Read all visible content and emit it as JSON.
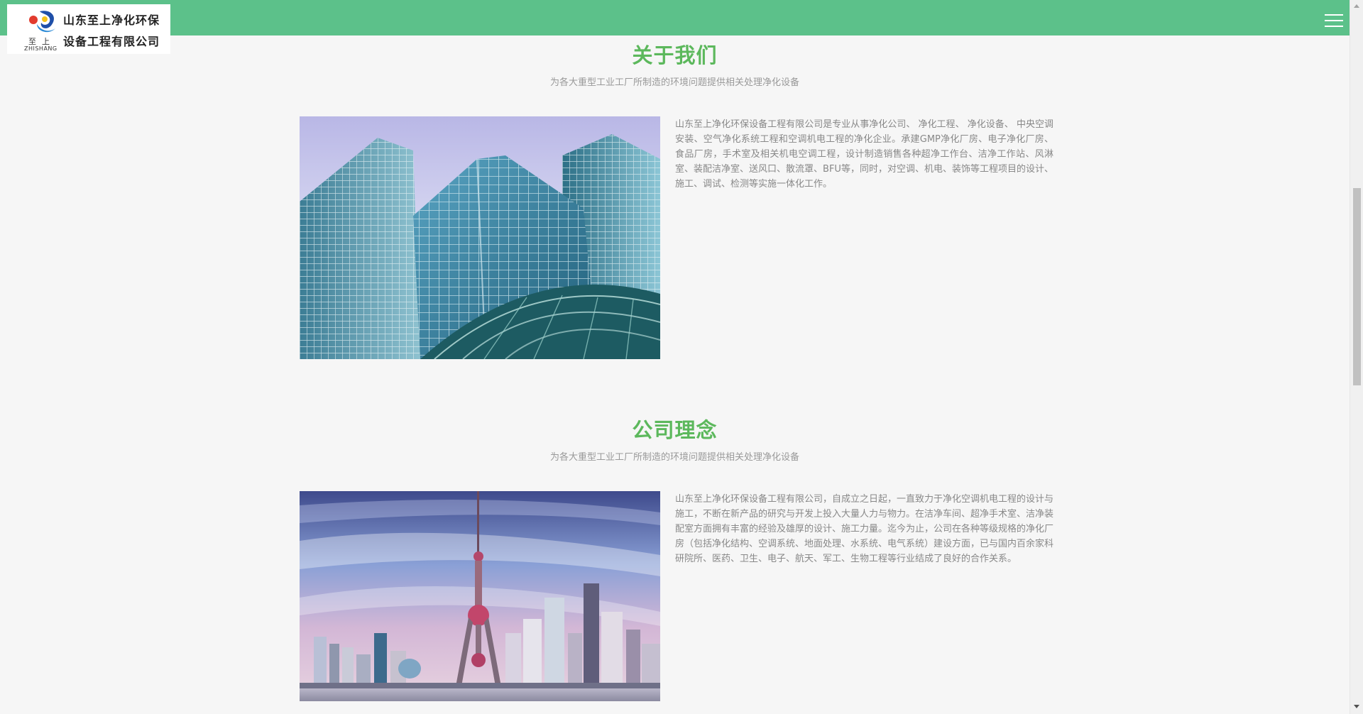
{
  "header": {
    "company_line1": "山东至上净化环保",
    "company_line2": "设备工程有限公司",
    "logo_mark_cn": "至上",
    "logo_mark_en": "ZHISHANG",
    "menu_icon": "hamburger-menu-icon",
    "bar_color": "#5cc18a"
  },
  "about": {
    "title": "关于我们",
    "subtitle": "为各大重型工业工厂所制造的环境问题提供相关处理净化设备",
    "paragraph": "山东至上净化环保设备工程有限公司是专业从事净化公司、 净化工程、 净化设备、 中央空调安装、空气净化系统工程和空调机电工程的净化企业。承建GMP净化厂房、电子净化厂房、食品厂房，手术室及相关机电空调工程，设计制造销售各种超净工作台、洁净工作站、风淋室、装配洁净室、送风口、散流罩、BFU等，同时，对空调、机电、装饰等工程项目的设计、施工、调试、检测等实施一体化工作。",
    "image": "glass-office-towers-photo"
  },
  "philosophy": {
    "title": "公司理念",
    "subtitle": "为各大重型工业工厂所制造的环境问题提供相关处理净化设备",
    "paragraph": "山东至上净化环保设备工程有限公司，自成立之日起，一直致力于净化空调机电工程的设计与施工，不断在新产品的研究与开发上投入大量人力与物力。在洁净车间、超净手术室、洁净装配室方面拥有丰富的经验及雄厚的设计、施工力量。迄今为止，公司在各种等级规格的净化厂房（包括净化结构、空调系统、地面处理、水系统、电气系统）建设方面，已与国内百余家科研院所、医药、卫生、电子、航天、军工、生物工程等行业结成了良好的合作关系。",
    "image": "shanghai-skyline-photo"
  },
  "colors": {
    "accent_green": "#5cb85c",
    "body_text": "#888888"
  }
}
